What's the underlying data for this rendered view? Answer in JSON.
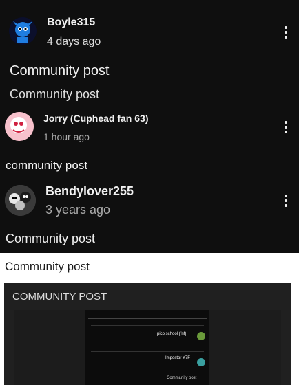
{
  "posts": [
    {
      "author": "Boyle315",
      "time": "4 days ago",
      "text": "Community post"
    },
    {
      "author": "Jorry (Cuphead fan 63)",
      "time": "1 hour ago",
      "text": "community post"
    },
    {
      "author": "Bendylover255",
      "time": "3 years ago",
      "text": "Community post"
    }
  ],
  "header_section_label": "Community post",
  "embedded": {
    "title": "Community post",
    "card_title": "COMMUNITY POST",
    "inner": {
      "row1_name": "pico school (fnf)",
      "row2_name": "Impostor Y7F",
      "row2_text": "Community post"
    }
  }
}
